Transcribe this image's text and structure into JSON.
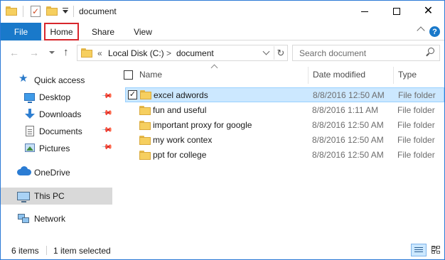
{
  "window": {
    "title": "document",
    "controls": {
      "minimize": "—",
      "maximize": "☐",
      "close": "✕"
    }
  },
  "ribbon": {
    "tabs": [
      {
        "label": "File"
      },
      {
        "label": "Home"
      },
      {
        "label": "Share"
      },
      {
        "label": "View"
      }
    ],
    "help": "?"
  },
  "address": {
    "overflow": "«",
    "path": [
      "Local Disk (C:)",
      "document"
    ],
    "separator": ">",
    "search_placeholder": "Search document"
  },
  "nav": {
    "quick_access": "Quick access",
    "items": [
      {
        "label": "Desktop"
      },
      {
        "label": "Downloads"
      },
      {
        "label": "Documents"
      },
      {
        "label": "Pictures"
      }
    ],
    "onedrive": "OneDrive",
    "this_pc": "This PC",
    "network": "Network"
  },
  "columns": {
    "name": "Name",
    "date": "Date modified",
    "type": "Type"
  },
  "rows": [
    {
      "name": "excel adwords",
      "date": "8/8/2016 12:50 AM",
      "type": "File folder",
      "selected": true
    },
    {
      "name": "fun and useful",
      "date": "8/8/2016 1:11 AM",
      "type": "File folder"
    },
    {
      "name": "important proxy for google",
      "date": "8/8/2016 12:50 AM",
      "type": "File folder"
    },
    {
      "name": "my work contex",
      "date": "8/8/2016 12:50 AM",
      "type": "File folder"
    },
    {
      "name": "ppt for college",
      "date": "8/8/2016 12:50 AM",
      "type": "File folder"
    }
  ],
  "status": {
    "count": "6 items",
    "selected": "1 item selected"
  },
  "colors": {
    "accent": "#1979ca",
    "selection": "#cce8ff",
    "highlight_box": "#d8262c",
    "folder": "#f6cf5f"
  }
}
